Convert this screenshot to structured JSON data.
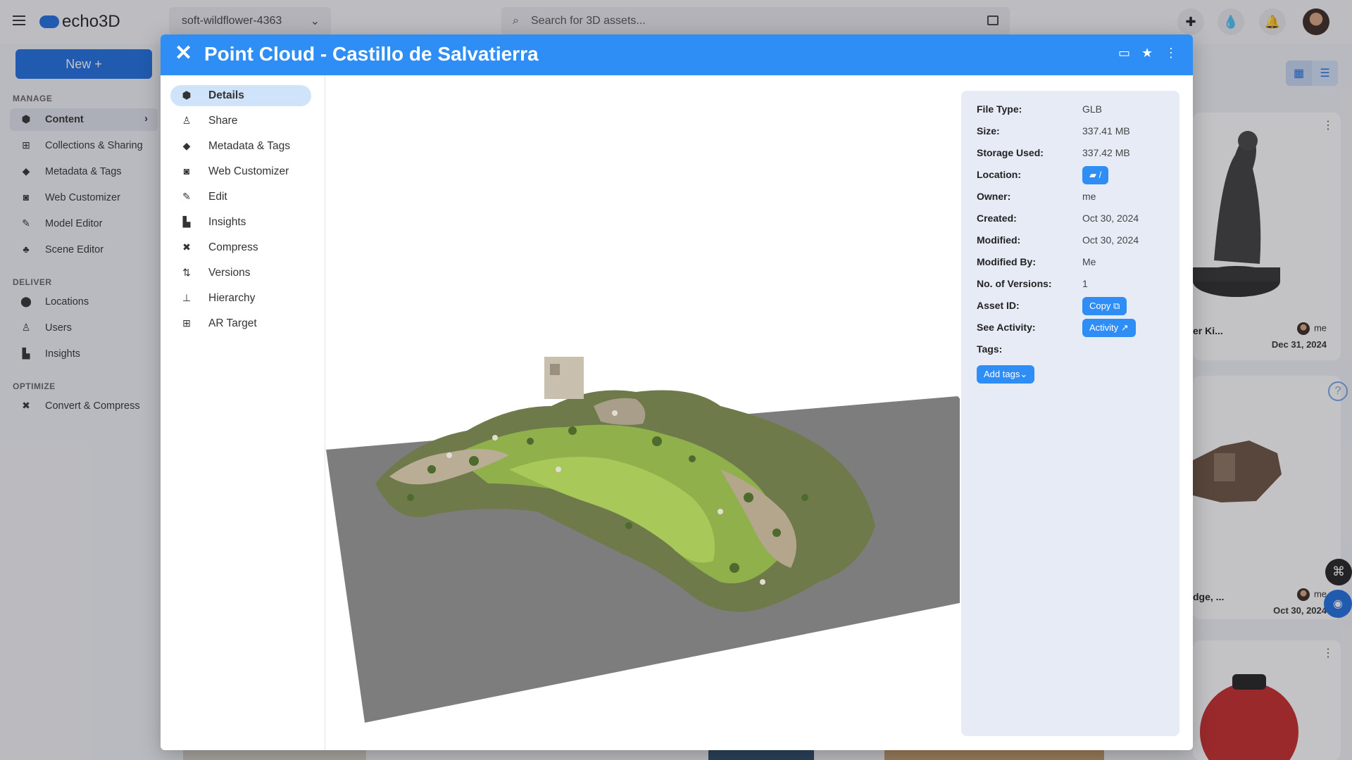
{
  "app": {
    "brand": "echo3D",
    "project": "soft-wildflower-4363",
    "search_placeholder": "Search for 3D assets...",
    "new_button": "New +"
  },
  "sidebar": {
    "sections": [
      {
        "label": "MANAGE",
        "items": [
          {
            "label": "Content",
            "icon": "cube-icon"
          },
          {
            "label": "Collections & Sharing",
            "icon": "grid-icon"
          },
          {
            "label": "Metadata & Tags",
            "icon": "tag-icon"
          },
          {
            "label": "Web Customizer",
            "icon": "vr-headset-icon"
          },
          {
            "label": "Model Editor",
            "icon": "pencil-icon"
          },
          {
            "label": "Scene Editor",
            "icon": "shapes-icon"
          }
        ]
      },
      {
        "label": "DELIVER",
        "items": [
          {
            "label": "Locations",
            "icon": "map-pin-icon"
          },
          {
            "label": "Users",
            "icon": "user-icon"
          },
          {
            "label": "Insights",
            "icon": "chart-icon"
          }
        ]
      },
      {
        "label": "OPTIMIZE",
        "items": [
          {
            "label": "Convert & Compress",
            "icon": "compress-icon"
          }
        ]
      }
    ]
  },
  "cards": [
    {
      "title": "er Ki...",
      "owner": "me",
      "date": "Dec 31, 2024"
    },
    {
      "title": "dge, ...",
      "owner": "me",
      "date": "Oct 30, 2024"
    }
  ],
  "modal": {
    "title": "Point Cloud - Castillo de Salvatierra",
    "nav": [
      {
        "label": "Details",
        "icon": "cube-icon",
        "active": true
      },
      {
        "label": "Share",
        "icon": "user-plus-icon"
      },
      {
        "label": "Metadata & Tags",
        "icon": "tag-icon"
      },
      {
        "label": "Web Customizer",
        "icon": "vr-headset-icon"
      },
      {
        "label": "Edit",
        "icon": "pencil-icon"
      },
      {
        "label": "Insights",
        "icon": "chart-icon"
      },
      {
        "label": "Compress",
        "icon": "compress-icon"
      },
      {
        "label": "Versions",
        "icon": "versions-icon"
      },
      {
        "label": "Hierarchy",
        "icon": "hierarchy-icon"
      },
      {
        "label": "AR Target",
        "icon": "qr-icon"
      }
    ],
    "details": {
      "file_type_label": "File Type:",
      "file_type": "GLB",
      "size_label": "Size:",
      "size": "337.41 MB",
      "storage_label": "Storage Used:",
      "storage": "337.42 MB",
      "location_label": "Location:",
      "location": "/",
      "owner_label": "Owner:",
      "owner": "me",
      "created_label": "Created:",
      "created": "Oct 30, 2024",
      "modified_label": "Modified:",
      "modified": "Oct 30, 2024",
      "modified_by_label": "Modified By:",
      "modified_by": "Me",
      "versions_label": "No. of Versions:",
      "versions": "1",
      "asset_id_label": "Asset ID:",
      "copy_button": "Copy",
      "activity_label": "See Activity:",
      "activity_button": "Activity",
      "tags_label": "Tags:",
      "add_tags_button": "Add tags"
    }
  },
  "colors": {
    "primary": "#2f8ef5",
    "brand_blue": "#1e6fe0",
    "panel_bg": "#e6ebf5",
    "active_nav": "#cfe3fb",
    "ground_plane": "#7d7d7d"
  }
}
